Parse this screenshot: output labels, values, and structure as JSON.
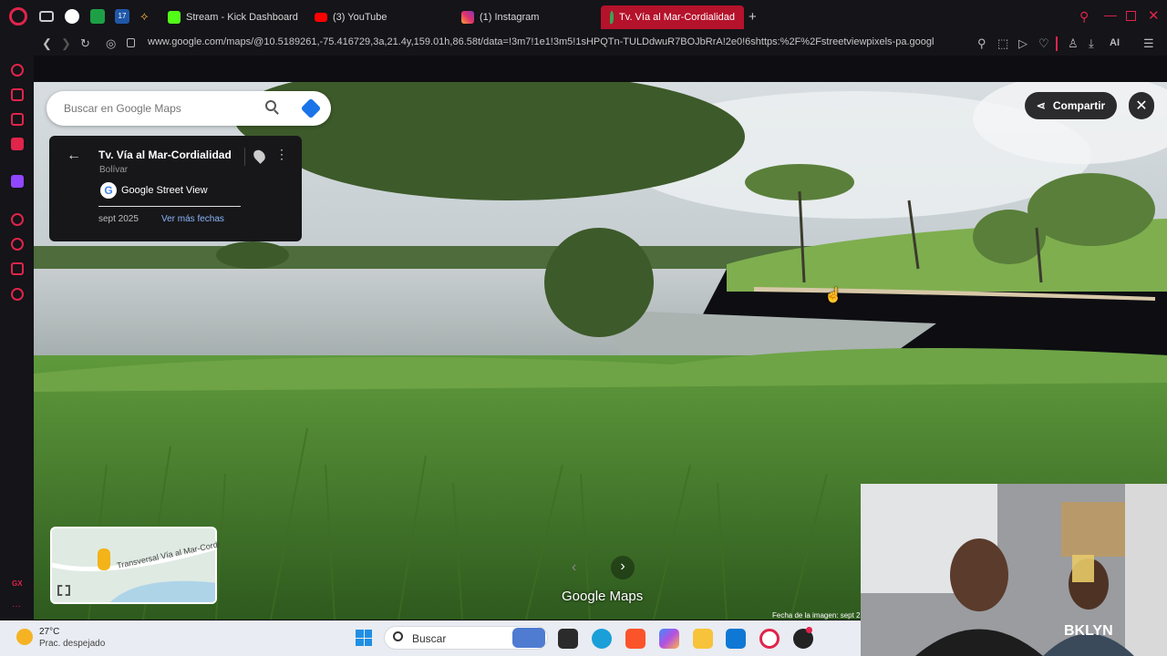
{
  "tabs": [
    {
      "label": "Stream - Kick Dashboard",
      "color": "#53fc18"
    },
    {
      "label": "(3) YouTube",
      "color": "#ff0000"
    },
    {
      "label": "(1) Instagram",
      "color": "#e1306c"
    },
    {
      "label": "Tv. Vía al Mar-Cordialidad",
      "color": "#34a853",
      "active": true
    }
  ],
  "address": {
    "url": "www.google.com/maps/@10.5189261,-75.416729,3a,21.4y,159.01h,86.58t/data=!3m7!1e1!3m5!1sHPQTn-TULDdwuR7BOJbRrA!2e0!6shttps:%2F%2Fstreetviewpixels-pa.googl",
    "ai_label": "AI"
  },
  "maps": {
    "search_placeholder": "Buscar en Google Maps",
    "place_title": "Tv. Vía al Mar-Cordialidad",
    "place_region": "Bolívar",
    "source_label": "Google Street View",
    "date": "sept 2025",
    "more_dates": "Ver más fechas",
    "share_label": "Compartir",
    "minimap_road": "Transversal Vía al Mar-Cordi",
    "brand": "Google Maps",
    "image_date": "Fecha de la imagen: sept 2"
  },
  "sidebar": {
    "gx_label": "GX",
    "more": "···"
  },
  "taskbar": {
    "weather_temp": "27°C",
    "weather_desc": "Prac. despejado",
    "search_label": "Buscar"
  },
  "webcam": {
    "shirt_text": "BKLYN"
  },
  "colors": {
    "accent": "#e0244a",
    "tab_active": "#b5122b",
    "maps_blue": "#1a73e8"
  }
}
